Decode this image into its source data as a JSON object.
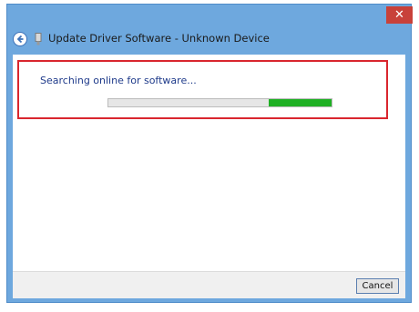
{
  "window": {
    "title": "Update Driver Software - Unknown Device",
    "close_label": "✕",
    "accent_color": "#6ea8de"
  },
  "icons": {
    "back": "back-arrow-icon",
    "device": "device-icon",
    "close": "close-icon"
  },
  "status": {
    "message": "Searching online for software..."
  },
  "progress": {
    "mode": "marquee",
    "segment_start_fraction": 0.72,
    "segment_end_fraction": 1.0,
    "fill_color": "#1fb024"
  },
  "footer": {
    "cancel_label": "Cancel"
  }
}
